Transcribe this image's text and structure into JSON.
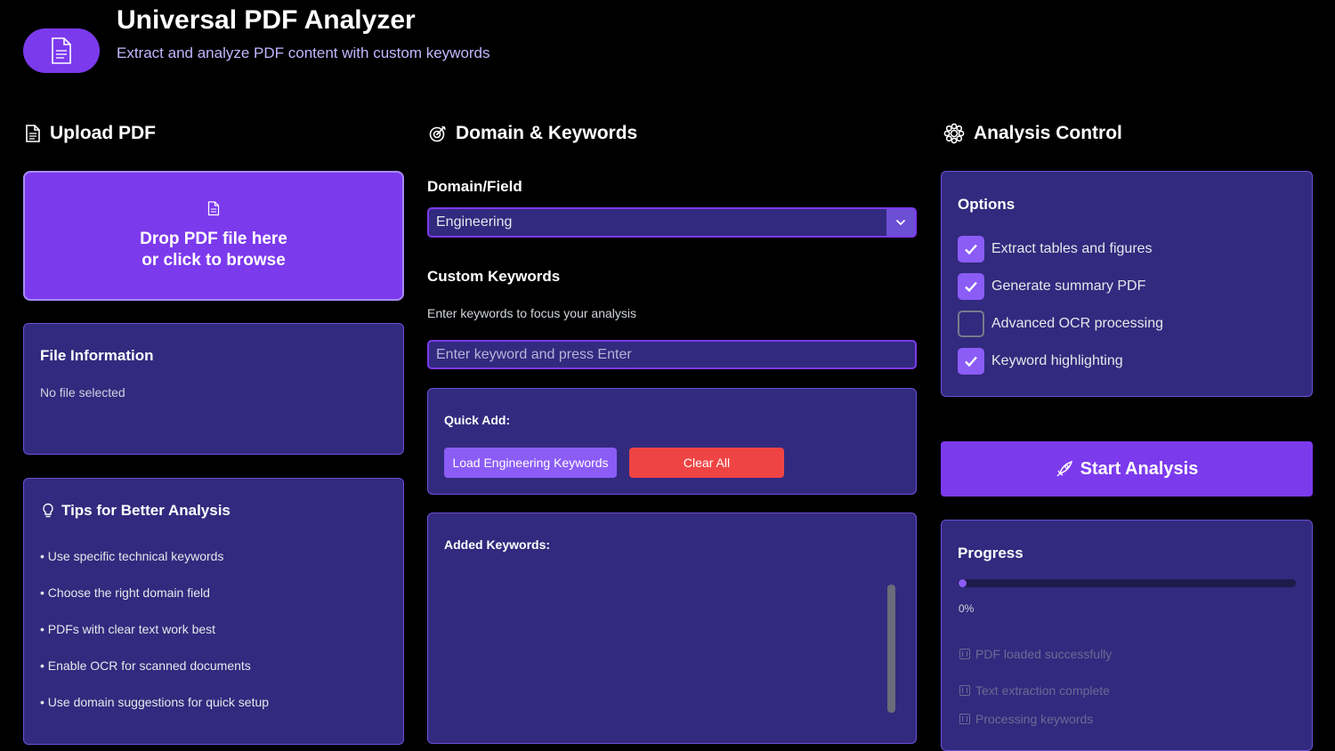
{
  "header": {
    "title": "Universal PDF Analyzer",
    "subtitle": "Extract and analyze PDF content with custom keywords"
  },
  "upload": {
    "section_title": "Upload PDF",
    "drop_line1": "Drop PDF file here",
    "drop_line2": "or click to browse",
    "file_info_title": "File Information",
    "file_info_text": "No file selected",
    "tips_title": "Tips for Better Analysis",
    "tips": [
      "• Use specific technical keywords",
      "• Choose the right domain field",
      "• PDFs with clear text work best",
      "• Enable OCR for scanned documents",
      "• Use domain suggestions for quick setup"
    ]
  },
  "domain": {
    "section_title": "Domain & Keywords",
    "field_label": "Domain/Field",
    "selected": "Engineering",
    "keywords_label": "Custom Keywords",
    "keywords_hint": "Enter keywords to focus your analysis",
    "keyword_placeholder": "Enter keyword and press Enter",
    "quick_add_label": "Quick Add:",
    "load_button": "Load Engineering Keywords",
    "clear_button": "Clear All",
    "added_label": "Added Keywords:"
  },
  "control": {
    "section_title": "Analysis Control",
    "options_title": "Options",
    "options": [
      {
        "label": "Extract tables and figures",
        "checked": true
      },
      {
        "label": "Generate summary PDF",
        "checked": true
      },
      {
        "label": "Advanced OCR processing",
        "checked": false
      },
      {
        "label": "Keyword highlighting",
        "checked": true
      }
    ],
    "start_button": "Start Analysis",
    "progress_title": "Progress",
    "progress_fraction": 0.0,
    "progress_text": "0%",
    "steps": [
      "PDF loaded successfully",
      "Text extraction complete",
      "Processing keywords"
    ]
  },
  "colors": {
    "accent": "#7c3aed",
    "panel": "#322a7e",
    "danger": "#ef4444",
    "background": "#000000"
  }
}
